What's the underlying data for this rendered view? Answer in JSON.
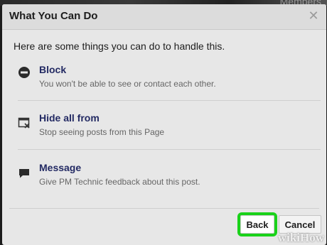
{
  "background": {
    "corner_text": "Members"
  },
  "dialog": {
    "title": "What You Can Do",
    "intro": "Here are some things you can do to handle this.",
    "options": [
      {
        "icon": "block-icon",
        "label": "Block",
        "description": "You won't be able to see or contact each other."
      },
      {
        "icon": "hide-window-icon",
        "label": "Hide all from",
        "description": "Stop seeing posts from this Page"
      },
      {
        "icon": "message-icon",
        "label": "Message",
        "description": "Give PM Technic feedback about this post."
      }
    ],
    "buttons": {
      "back": "Back",
      "cancel": "Cancel"
    }
  },
  "watermark": "wikiHow",
  "colors": {
    "highlight": "#1ad21a",
    "link": "#232a63",
    "dialog_bg": "#e7e7e7"
  }
}
